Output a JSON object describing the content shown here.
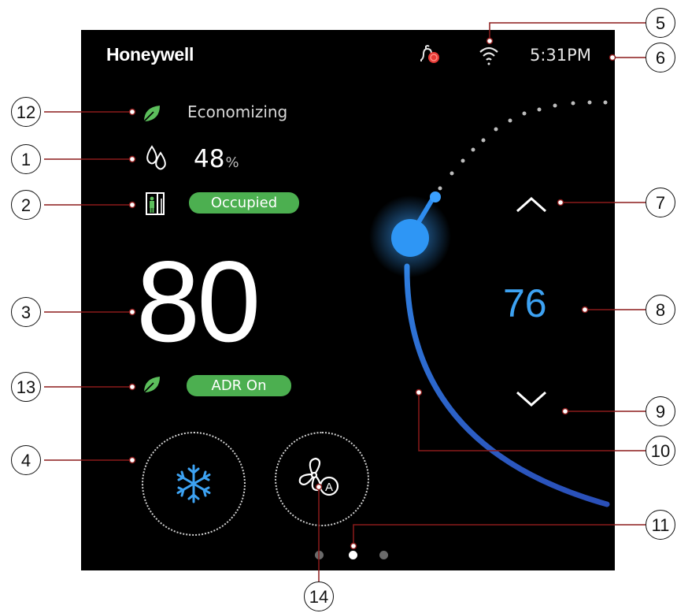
{
  "header": {
    "brand": "Honeywell",
    "time": "5:31PM",
    "icons": [
      "alert-bell-icon",
      "wifi-icon"
    ]
  },
  "status": {
    "economizing_label": "Economizing",
    "humidity_value": "48",
    "humidity_unit": "%",
    "occupancy_label": "Occupied",
    "adr_label": "ADR On"
  },
  "temperature": {
    "current": "80",
    "setpoint": "76"
  },
  "controls": {
    "mode_icon": "snowflake-icon",
    "fan_icon": "fan-auto-icon",
    "page_indicator": {
      "pages": 3,
      "active_page": 2
    }
  },
  "colors": {
    "accent_blue": "#3da2f2",
    "pill_green": "#4caf50",
    "leaf_green": "#5cbf5c",
    "alert_red": "#e53935"
  },
  "callouts": [
    "1",
    "2",
    "3",
    "4",
    "5",
    "6",
    "7",
    "8",
    "9",
    "10",
    "11",
    "12",
    "13",
    "14"
  ]
}
